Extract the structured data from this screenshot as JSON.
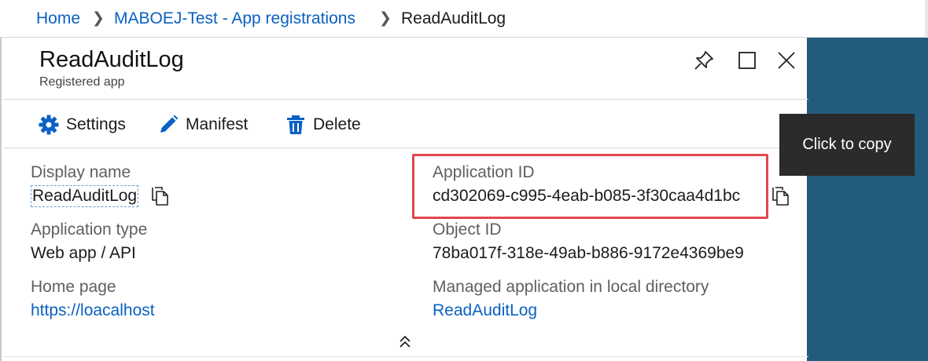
{
  "breadcrumb": {
    "items": [
      {
        "label": "Home"
      },
      {
        "label": "MABOEJ-Test - App registrations"
      },
      {
        "label": "ReadAuditLog"
      }
    ]
  },
  "blade": {
    "title": "ReadAuditLog",
    "subtitle": "Registered app"
  },
  "toolbar": {
    "settings_label": "Settings",
    "manifest_label": "Manifest",
    "delete_label": "Delete"
  },
  "essentials": {
    "display_name": {
      "label": "Display name",
      "value": "ReadAuditLog"
    },
    "application_type": {
      "label": "Application type",
      "value": "Web app / API"
    },
    "home_page": {
      "label": "Home page",
      "value": "https://loacalhost"
    },
    "application_id": {
      "label": "Application ID",
      "value": "cd302069-c995-4eab-b085-3f30caa4d1bc"
    },
    "object_id": {
      "label": "Object ID",
      "value": "78ba017f-318e-49ab-b886-9172e4369be9"
    },
    "managed_app": {
      "label": "Managed application in local directory",
      "value": "ReadAuditLog"
    }
  },
  "tooltip": {
    "text": "Click to copy"
  },
  "icons": {
    "settings": "gear-icon",
    "manifest": "pencil-icon",
    "delete": "trash-icon",
    "copy": "copy-icon",
    "pin": "pin-icon",
    "maximize": "maximize-icon",
    "close": "close-icon",
    "collapse": "double-chevron-up-icon"
  },
  "colors": {
    "link": "#0a60c2",
    "accent_icon": "#0b62c4",
    "side_panel": "#235b7c",
    "highlight": "#e0464f",
    "tooltip_bg": "#2b2b2b"
  }
}
